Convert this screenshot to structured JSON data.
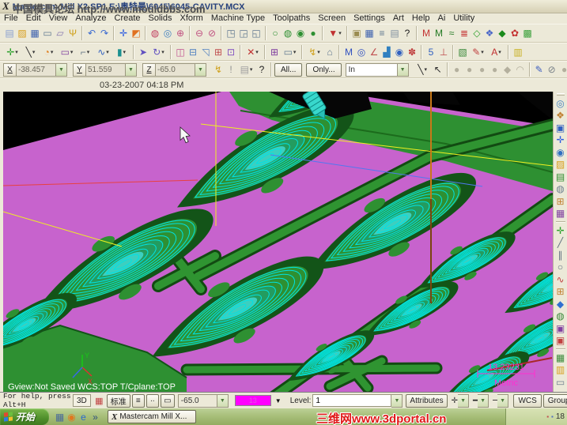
{
  "window": {
    "title": "Mastercam Mill X2 SP1   E:\\奥特曼\\6045\\6045-CAVITY.MCX",
    "app_icon": "X"
  },
  "watermarks": {
    "top": "中国模具论坛 http://www.mouldbbs.com",
    "bottom": "三维网www.3dportal.cn"
  },
  "menu": {
    "items": [
      "File",
      "Edit",
      "View",
      "Analyze",
      "Create",
      "Solids",
      "Xform",
      "Machine Type",
      "Toolpaths",
      "Screen",
      "Settings",
      "Art",
      "Help",
      "Ai",
      "Utility"
    ]
  },
  "toolbar_row1": [
    {
      "n": "new-file",
      "g": "▤",
      "c": "#8aa0d0"
    },
    {
      "n": "open-folder",
      "g": "▨",
      "c": "#d8a020"
    },
    {
      "n": "save",
      "g": "▦",
      "c": "#3a5fae"
    },
    {
      "n": "print",
      "g": "▭",
      "c": "#607890"
    },
    {
      "n": "print-preview",
      "g": "▱",
      "c": "#8878b0"
    },
    {
      "n": "trophy",
      "g": "Ψ",
      "c": "#cfa01a"
    },
    {
      "sep": true
    },
    {
      "n": "undo",
      "g": "↶",
      "c": "#3a6ad0"
    },
    {
      "n": "redo",
      "g": "↷",
      "c": "#3a6ad0"
    },
    {
      "sep": true
    },
    {
      "n": "pan",
      "g": "✛",
      "c": "#2a5ae0"
    },
    {
      "n": "repaint",
      "g": "◩",
      "c": "#e07020"
    },
    {
      "sep": true
    },
    {
      "n": "zoom-window",
      "g": "◍",
      "c": "#c04060"
    },
    {
      "n": "zoom-target",
      "g": "◎",
      "c": "#4080c0"
    },
    {
      "n": "zoom-in",
      "g": "⊕",
      "c": "#c05080"
    },
    {
      "sep": true
    },
    {
      "n": "zoom-out",
      "g": "⊖",
      "c": "#c05080"
    },
    {
      "n": "zoom-previous",
      "g": "⊘",
      "c": "#c05080"
    },
    {
      "sep": true
    },
    {
      "n": "gview-mouse-1",
      "g": "◳",
      "c": "#607890"
    },
    {
      "n": "gview-mouse-2",
      "g": "◲",
      "c": "#607890"
    },
    {
      "n": "gview-mouse-3",
      "g": "◱",
      "c": "#607890"
    },
    {
      "sep": true
    },
    {
      "n": "shading-wireframe",
      "g": "○",
      "c": "#2e9032"
    },
    {
      "n": "shading-hidden",
      "g": "◍",
      "c": "#2e9032"
    },
    {
      "n": "shading-translucent",
      "g": "◉",
      "c": "#2e9032"
    },
    {
      "n": "shading-shaded",
      "g": "●",
      "c": "#2e9032"
    },
    {
      "sep": true
    },
    {
      "n": "selection-mask",
      "g": "▼",
      "c": "#c03030",
      "dd": true
    },
    {
      "sep": true
    },
    {
      "n": "run-chook",
      "g": "▣",
      "c": "#9a8c52"
    },
    {
      "n": "save-some",
      "g": "▦",
      "c": "#3a5fae"
    },
    {
      "n": "session-log",
      "g": "≡",
      "c": "#607890"
    },
    {
      "n": "notes",
      "g": "▤",
      "c": "#8090a0"
    },
    {
      "n": "help",
      "g": "?",
      "c": "#202020"
    },
    {
      "sep": true
    },
    {
      "n": "analyze-entity-m",
      "g": "M",
      "c": "#c43030"
    },
    {
      "n": "analyze-dynamic-m",
      "g": "M",
      "c": "#237a23"
    },
    {
      "n": "toolpath-wave",
      "g": "≈",
      "c": "#237a23"
    },
    {
      "n": "toolpath-drill",
      "g": "≣",
      "c": "#c43030"
    },
    {
      "n": "toolpath-pocket",
      "g": "◇",
      "c": "#2aa02a"
    },
    {
      "n": "toolpath-face",
      "g": "❖",
      "c": "#4a66c8"
    },
    {
      "n": "toolpath-surface-rough",
      "g": "◆",
      "c": "#1a8a1a"
    },
    {
      "n": "toolpath-flowline",
      "g": "✿",
      "c": "#c43030"
    },
    {
      "n": "toolpath-verify",
      "g": "▩",
      "c": "#3aa03a"
    }
  ],
  "toolbar_row2": [
    {
      "n": "create-point",
      "g": "✛",
      "c": "#2aa02a",
      "dd": true
    },
    {
      "n": "create-line",
      "g": "╲",
      "c": "#282828",
      "dd": true
    },
    {
      "n": "create-arc",
      "g": "◔",
      "c": "#e08020",
      "dd": true
    },
    {
      "n": "create-rectangle",
      "g": "▭",
      "c": "#8040a0",
      "dd": true
    },
    {
      "n": "create-fillet",
      "g": "⌐",
      "c": "#687888",
      "dd": true
    },
    {
      "n": "create-spline",
      "g": "∿",
      "c": "#3060c0",
      "dd": true
    },
    {
      "n": "create-solid-primitive",
      "g": "▮",
      "c": "#1a9090",
      "dd": true
    },
    {
      "sep": true
    },
    {
      "n": "xform-translate",
      "g": "➤",
      "c": "#6050c0"
    },
    {
      "n": "xform-rotate",
      "g": "↻",
      "c": "#6050c0",
      "dd": true
    },
    {
      "sep": true
    },
    {
      "n": "xform-mirror",
      "g": "◫",
      "c": "#c05090"
    },
    {
      "n": "xform-offset",
      "g": "⊟",
      "c": "#5080c0"
    },
    {
      "n": "xform-scale",
      "g": "◹",
      "c": "#5080c0"
    },
    {
      "n": "xform-array",
      "g": "⊞",
      "c": "#c05050"
    },
    {
      "n": "xform-project",
      "g": "⊡",
      "c": "#8050c0"
    },
    {
      "sep": true
    },
    {
      "n": "delete-entities",
      "g": "✕",
      "c": "#c03030",
      "dd": true
    },
    {
      "sep": true
    },
    {
      "n": "machine-group-properties",
      "g": "⊞",
      "c": "#8040a0"
    },
    {
      "n": "screen-combine",
      "g": "▭",
      "c": "#607890",
      "dd": true
    },
    {
      "sep": true
    },
    {
      "n": "utilities-key",
      "g": "↯",
      "c": "#cfa01a",
      "dd": true
    },
    {
      "n": "utilities-config",
      "g": "⌂",
      "c": "#607890"
    },
    {
      "sep": true
    },
    {
      "n": "analyze-distance",
      "g": "M",
      "c": "#3050c0"
    },
    {
      "n": "analyze-contour",
      "g": "◎",
      "c": "#3050c0"
    },
    {
      "n": "analyze-angle",
      "g": "∠",
      "c": "#c05050"
    },
    {
      "n": "analyze-chart",
      "g": "▟",
      "c": "#3080c0"
    },
    {
      "n": "analyze-dynamic",
      "g": "◉",
      "c": "#3060c0"
    },
    {
      "n": "analyze-surface-test",
      "g": "✽",
      "c": "#c04040"
    },
    {
      "sep": true
    },
    {
      "n": "five-axis",
      "g": "5",
      "c": "#3060c0"
    },
    {
      "n": "tool-settings",
      "g": "⊥",
      "c": "#c05050"
    },
    {
      "sep": true
    },
    {
      "n": "raster-to-vector",
      "g": "▧",
      "c": "#3a8a3a"
    },
    {
      "n": "drafting-dimension",
      "g": "✎",
      "c": "#c04040",
      "dd": true
    },
    {
      "n": "create-letters",
      "g": "A",
      "c": "#c03030",
      "dd": true
    },
    {
      "sep": true
    },
    {
      "n": "highlight-toolbar",
      "g": "▥",
      "c": "#c8b020"
    }
  ],
  "coords": {
    "x_label": "X",
    "x_value": "-38.457",
    "y_label": "Y",
    "y_value": "51.559",
    "z_label": "Z",
    "z_value": "-65.0"
  },
  "row3_icons_a": [
    {
      "n": "fastpoint",
      "g": "↯",
      "c": "#cfa01a"
    },
    {
      "n": "apply-warning",
      "g": "!",
      "c": "#909090"
    },
    {
      "n": "clipboard",
      "g": "▤",
      "c": "#a0a0a0",
      "dd": true
    },
    {
      "n": "help-coords",
      "g": "?",
      "c": "#202020"
    }
  ],
  "selection": {
    "all_label": "All...",
    "only_label": "Only...",
    "in_value": "In"
  },
  "row3_icons_b": [
    {
      "n": "chain-line",
      "g": "╲",
      "c": "#282828",
      "dd": true
    },
    {
      "n": "select-cursor",
      "g": "↖",
      "c": "#303030"
    },
    {
      "sep": true
    },
    {
      "n": "select-1",
      "g": "●",
      "c": "#b4b09e",
      "dis": true
    },
    {
      "n": "select-2",
      "g": "●",
      "c": "#b4b09e",
      "dis": true
    },
    {
      "n": "select-3",
      "g": "●",
      "c": "#b4b09e",
      "dis": true
    },
    {
      "n": "select-4",
      "g": "●",
      "c": "#b4b09e",
      "dis": true
    },
    {
      "n": "select-5",
      "g": "◆",
      "c": "#b4b09e",
      "dis": true
    },
    {
      "n": "select-6",
      "g": "◠",
      "c": "#b4b09e",
      "dis": true
    },
    {
      "sep": true
    },
    {
      "n": "quick-mask-pencil",
      "g": "✎",
      "c": "#4060c0"
    },
    {
      "n": "select-null",
      "g": "⊘",
      "c": "#788088"
    },
    {
      "n": "select-result",
      "g": "●",
      "c": "#b4b09e",
      "dis": true
    },
    {
      "n": "help-selection",
      "g": "?",
      "c": "#202020"
    }
  ],
  "right_toolbar": [
    {
      "n": "zoom-fit",
      "g": "◎",
      "c": "#4080c0"
    },
    {
      "n": "shaded-view",
      "g": "❖",
      "c": "#c08030"
    },
    {
      "n": "viewport-single",
      "g": "▣",
      "c": "#3060c0"
    },
    {
      "n": "pan-view",
      "g": "✛",
      "c": "#2a5ae0"
    },
    {
      "n": "rotate-view",
      "g": "◉",
      "c": "#3070c0"
    },
    {
      "n": "open-level",
      "g": "▨",
      "c": "#d8a020"
    },
    {
      "n": "level-manager",
      "g": "▤",
      "c": "#2a8a2a"
    },
    {
      "n": "isometric-view",
      "g": "◍",
      "c": "#708090"
    },
    {
      "n": "view-window",
      "g": "⊞",
      "c": "#c08030"
    },
    {
      "n": "grid-settings",
      "g": "▦",
      "c": "#8040a0"
    },
    {
      "sep": true
    },
    {
      "n": "create-point-side",
      "g": "✛",
      "c": "#2aa02a"
    },
    {
      "n": "sketch-line",
      "g": "╱",
      "c": "#607080"
    },
    {
      "n": "sketch-polyline",
      "g": "∥",
      "c": "#607080"
    },
    {
      "n": "sketch-circle",
      "g": "○",
      "c": "#607080"
    },
    {
      "n": "sketch-spline",
      "g": "∿",
      "c": "#c04040"
    },
    {
      "n": "surface-net",
      "g": "⊞",
      "c": "#c08030"
    },
    {
      "n": "surface-create",
      "g": "◆",
      "c": "#3070d0"
    },
    {
      "n": "solid-sphere",
      "g": "◍",
      "c": "#3a8a3a"
    },
    {
      "n": "solid-block",
      "g": "▣",
      "c": "#8040a0"
    },
    {
      "n": "solid-boolean",
      "g": "▣",
      "c": "#c04040"
    },
    {
      "sep": true
    },
    {
      "n": "toolpath-grid",
      "g": "▦",
      "c": "#3a8a3a"
    },
    {
      "n": "machine-def",
      "g": "▥",
      "c": "#d8a020"
    },
    {
      "n": "camera-view",
      "g": "▭",
      "c": "#708090"
    }
  ],
  "viewport": {
    "timestamp": "03-23-2007 04:18 PM",
    "gview_status": "Gview:Not Saved   WCS:TOP   T/Cplane:TOP",
    "ruler_value": "13.23231",
    "units": "Metric",
    "axis_x": "X",
    "axis_y": "Y"
  },
  "statusbar": {
    "help_text": "For help, press Alt+H",
    "view_mode": "3D",
    "gview_icon": "▦",
    "standard_label": "标准",
    "btn1": "≡",
    "btn2": "∙∙",
    "btn3": "▭",
    "z_depth": "-65.0",
    "color_number": "13",
    "level_label": "Level:",
    "level_value": "1",
    "attributes_label": "Attributes",
    "point_style": "✛",
    "line_style": "━",
    "line_width": "─",
    "wcs_label": "WCS",
    "groups_label": "Groups"
  },
  "taskbar": {
    "start_label": "开始",
    "quick": [
      {
        "n": "show-desktop",
        "g": "▦",
        "c": "#4a6a9a"
      },
      {
        "n": "media-player",
        "g": "◉",
        "c": "#e07820"
      },
      {
        "n": "internet-explorer",
        "g": "e",
        "c": "#2a6ad0"
      },
      {
        "n": "more-quick-launch",
        "g": "»",
        "c": "#305080"
      }
    ],
    "task_label": "Mastercam Mill X...",
    "task_logo": "X",
    "tray_icons": [
      {
        "n": "tray-icon-1",
        "g": "▪",
        "c": "#c05050"
      },
      {
        "n": "tray-icon-2",
        "g": "▪",
        "c": "#5070c0"
      }
    ],
    "tray_time": "18"
  },
  "colors": {
    "plate_violet": "#c763cd",
    "solid_green": "#2e9032",
    "toolpath_cyan": "#00e2e2",
    "ruler_magenta": "#ff2fd0",
    "active_color_swatch": "#ff00ff"
  }
}
